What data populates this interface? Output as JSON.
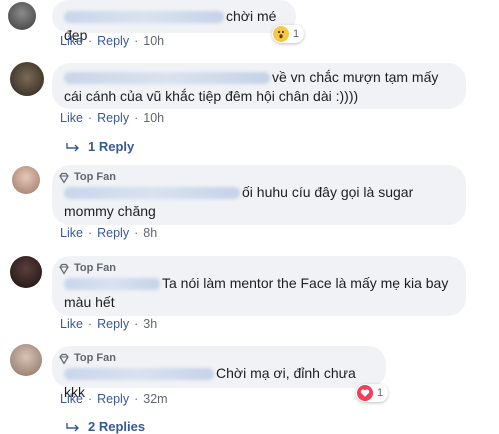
{
  "comments": [
    {
      "author": "Trần Quyên Phương Nghi",
      "text": "chời mé đẹp",
      "like_label": "Like",
      "reply_label": "Reply",
      "time": "10h",
      "reaction": {
        "icon": "wow-reaction-icon",
        "count": "1"
      }
    },
    {
      "author": "Nguyễn Hoàng Ngọc Long Hải",
      "text": "về vn chắc mượn tạm mấy cái cánh của vũ khắc tiệp đêm hội chân dài :))))",
      "like_label": "Like",
      "reply_label": "Reply",
      "time": "10h",
      "replies_link": "1 Reply"
    },
    {
      "badge": "Top Fan",
      "author": "Minh Nhu Diễm Thanh Trần",
      "text": "ối huhu cíu đây gọi là sugar mommy chăng",
      "like_label": "Like",
      "reply_label": "Reply",
      "time": "8h"
    },
    {
      "badge": "Top Fan",
      "author": "Tuyền Lombard",
      "text": "Ta nói làm mentor the Face là mấy mẹ kia bay màu hết",
      "like_label": "Like",
      "reply_label": "Reply",
      "time": "3h"
    },
    {
      "badge": "Top Fan",
      "author": "Ngân Nguyễn Trần Quyên",
      "text": "Chời mạ ơi, đỉnh chưa kkk",
      "like_label": "Like",
      "reply_label": "Reply",
      "time": "32m",
      "reaction": {
        "icon": "love-reaction-icon",
        "count": "1"
      },
      "replies_link": "2 Replies"
    }
  ],
  "colors": {
    "link": "#385898",
    "bubble": "#f0f2f5",
    "meta": "#606770"
  }
}
